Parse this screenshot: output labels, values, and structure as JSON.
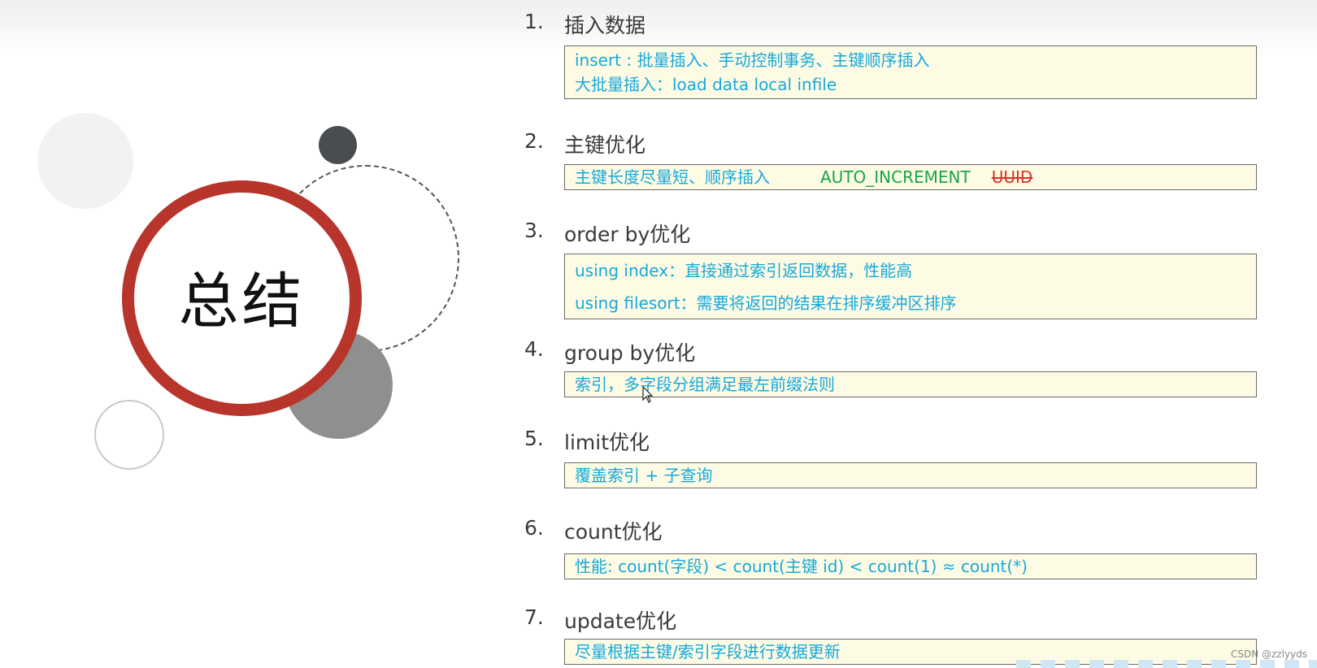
{
  "slide_title": "总结",
  "sections": [
    {
      "num": "1.",
      "title": "插入数据",
      "lines": [
        "insert : 批量插入、手动控制事务、主键顺序插入",
        "大批量插入：load  data  local  infile"
      ]
    },
    {
      "num": "2.",
      "title": "主键优化",
      "line": "主键长度尽量短、顺序插入",
      "green": "AUTO_INCREMENT",
      "strike": "UUID"
    },
    {
      "num": "3.",
      "title": "order by优化",
      "lines": [
        "using index：直接通过索引返回数据，性能高",
        "using filesort：需要将返回的结果在排序缓冲区排序"
      ]
    },
    {
      "num": "4.",
      "title": "group by优化",
      "line": "索引，多字段分组满足最左前缀法则"
    },
    {
      "num": "5.",
      "title": "limit优化",
      "line": "覆盖索引 + 子查询"
    },
    {
      "num": "6.",
      "title": "count优化",
      "line": "性能: count(字段) < count(主键 id) < count(1) ≈ count(*)"
    },
    {
      "num": "7.",
      "title": "update优化",
      "line": "尽量根据主键/索引字段进行数据更新"
    }
  ],
  "watermark": "CSDN @zzlyyds",
  "colors": {
    "accent_red": "#b8352c",
    "text_blue": "#17a8dc",
    "text_green": "#1aa54a",
    "box_bg": "#fdfbe3"
  }
}
